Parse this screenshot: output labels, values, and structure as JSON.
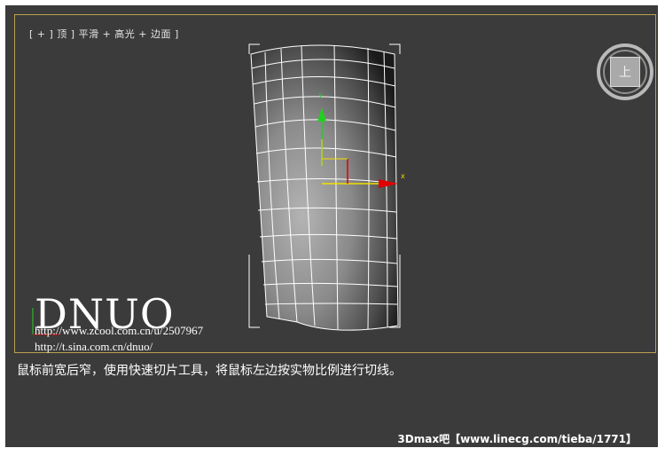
{
  "viewport": {
    "label": "[ + ] 顶 ] 平滑 + 高光 + 边面 ]",
    "gizmo": {
      "x_label": "x",
      "y_label": "y"
    }
  },
  "viewcube": {
    "face_label": "上"
  },
  "watermark": {
    "brand": "DNUO",
    "link1": "http://www.zcool.com.cn/u/2507967",
    "link2": "http://t.sina.com.cn/dnuo/"
  },
  "caption": "鼠标前宽后窄，使用快速切片工具，将鼠标左边按实物比例进行切线。",
  "footer_watermark": "3Dmax吧【www.linecg.com/tieba/1771】",
  "colors": {
    "viewport_bg": "#3b3b3b",
    "viewport_border": "#b9a050",
    "axis_x": "#f0e000",
    "axis_y": "#20d020",
    "axis_red": "#e00000"
  }
}
